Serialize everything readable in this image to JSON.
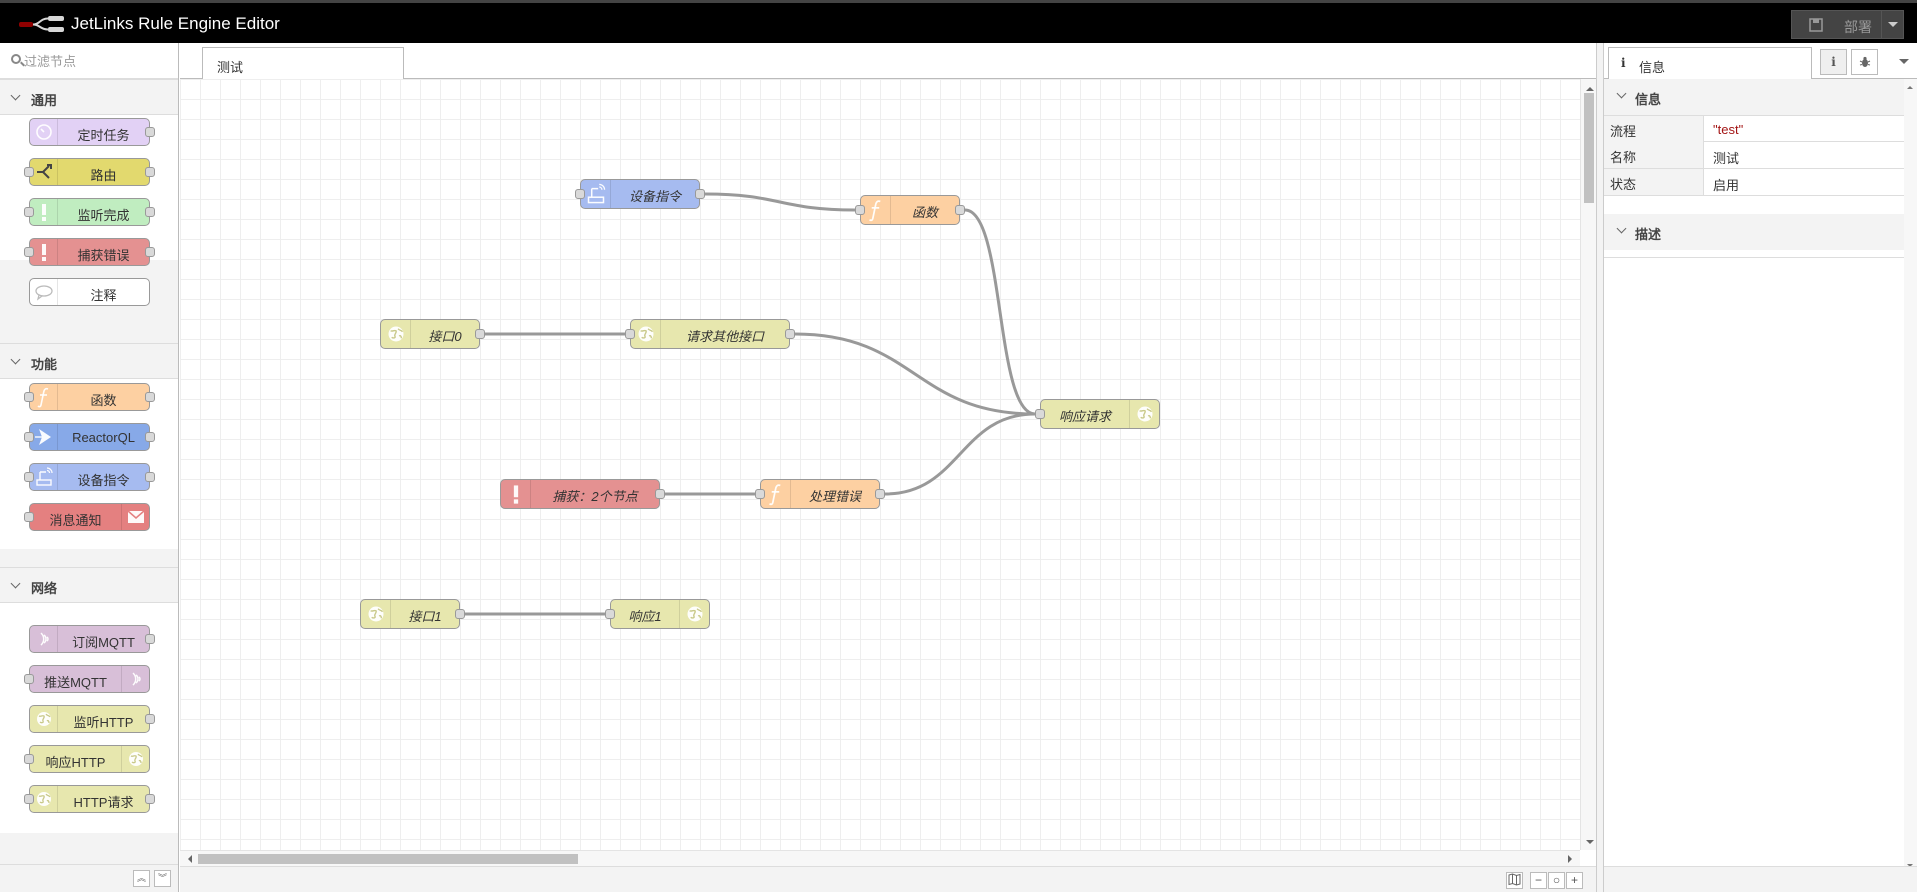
{
  "header": {
    "title": "JetLinks Rule Engine Editor",
    "deploy_label": "部署"
  },
  "palette": {
    "search_placeholder": "过滤节点",
    "categories": [
      {
        "label": "通用",
        "nodes": [
          {
            "label": "定时任务",
            "color": "#e2d1f5",
            "icon": "timer-icon"
          },
          {
            "label": "路由",
            "color": "#e2d96e",
            "icon": "switch-icon"
          },
          {
            "label": "监听完成",
            "color": "#c0edc0",
            "icon": "alert-icon"
          },
          {
            "label": "捕获错误",
            "color": "#e49191",
            "icon": "alert-icon"
          },
          {
            "label": "注释",
            "color": "#ffffff",
            "icon": "comment-icon"
          }
        ]
      },
      {
        "label": "功能",
        "nodes": [
          {
            "label": "函数",
            "color": "#fdd0a2",
            "icon": "function-icon"
          },
          {
            "label": "ReactorQL",
            "color": "#87a9e8",
            "icon": "reactorql-icon"
          },
          {
            "label": "设备指令",
            "color": "#a6bbf0",
            "icon": "device-icon"
          },
          {
            "label": "消息通知",
            "color": "#e48080",
            "icon": "envelope-icon"
          }
        ]
      },
      {
        "label": "网络",
        "nodes": [
          {
            "label": "订阅MQTT",
            "color": "#d8bfd8",
            "icon": "bridge-icon"
          },
          {
            "label": "推送MQTT",
            "color": "#d8bfd8",
            "icon": "bridge-icon"
          },
          {
            "label": "监听HTTP",
            "color": "#e7e7ae",
            "icon": "web-icon"
          },
          {
            "label": "响应HTTP",
            "color": "#e7e7ae",
            "icon": "web-icon"
          },
          {
            "label": "HTTP请求",
            "color": "#e7e7ae",
            "icon": "web-icon"
          }
        ]
      }
    ]
  },
  "workspace": {
    "tab_label": "测试",
    "nodes": [
      {
        "id": "n1",
        "label": "设备指令",
        "color": "#a6bbf0",
        "icon": "device-icon"
      },
      {
        "id": "n2",
        "label": "函数",
        "color": "#fdd0a2",
        "icon": "function-icon"
      },
      {
        "id": "n3",
        "label": "接口0",
        "color": "#e7e7ae",
        "icon": "web-icon"
      },
      {
        "id": "n4",
        "label": "请求其他接口",
        "color": "#e7e7ae",
        "icon": "web-icon"
      },
      {
        "id": "n5",
        "label": "响应请求",
        "color": "#e7e7ae",
        "icon": "web-icon"
      },
      {
        "id": "n6",
        "label": "捕获：2个节点",
        "color": "#e49191",
        "icon": "alert-icon"
      },
      {
        "id": "n7",
        "label": "处理错误",
        "color": "#fdd0a2",
        "icon": "function-icon"
      },
      {
        "id": "n8",
        "label": "接口1",
        "color": "#e7e7ae",
        "icon": "web-icon"
      },
      {
        "id": "n9",
        "label": "响应1",
        "color": "#e7e7ae",
        "icon": "web-icon"
      }
    ],
    "wires": [
      [
        "n1",
        "n2"
      ],
      [
        "n2",
        "n5"
      ],
      [
        "n3",
        "n4"
      ],
      [
        "n4",
        "n5"
      ],
      [
        "n6",
        "n7"
      ],
      [
        "n7",
        "n5"
      ],
      [
        "n8",
        "n9"
      ]
    ]
  },
  "sidebar": {
    "tab_label": "信息",
    "info_section": "信息",
    "rows": [
      {
        "key": "流程",
        "value": "\"test\""
      },
      {
        "key": "名称",
        "value": "测试"
      },
      {
        "key": "状态",
        "value": "启用"
      }
    ],
    "desc_section": "描述"
  },
  "colors": {
    "accent_string": "#a31515",
    "wire": "#999999"
  }
}
